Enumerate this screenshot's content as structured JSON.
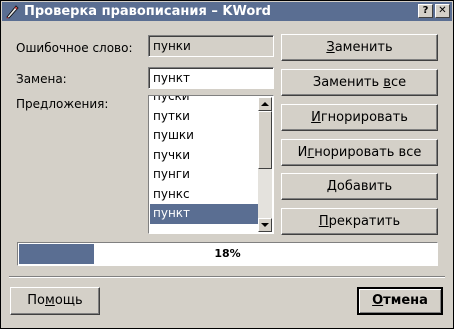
{
  "window": {
    "title": "Проверка правописания – KWord",
    "help_glyph": "?",
    "close_glyph": "✕",
    "icon": "kword-app-icon",
    "title_bar_color": "#5a6e92"
  },
  "form": {
    "misspelled_label": "Ошибочное слово:",
    "misspelled_value": "пунки",
    "replacement_label": "Замена:",
    "replacement_value": "пункт",
    "suggestions_label": "Предложения:"
  },
  "suggestions": {
    "items": [
      "пуски",
      "путки",
      "пушки",
      "пучки",
      "пунги",
      "пункс",
      "пункт"
    ],
    "selected_index": 6
  },
  "buttons": {
    "replace": {
      "pre": "",
      "mnemonic": "З",
      "post": "аменить"
    },
    "replace_all": {
      "pre": "Заменить ",
      "mnemonic": "в",
      "post": "се"
    },
    "ignore": {
      "pre": "",
      "mnemonic": "И",
      "post": "гнорировать"
    },
    "ignore_all": {
      "pre": "И",
      "mnemonic": "г",
      "post": "норировать все"
    },
    "add": {
      "pre": "",
      "mnemonic": "Д",
      "post": "обавить"
    },
    "stop": {
      "pre": "",
      "mnemonic": "П",
      "post": "рекратить"
    }
  },
  "progress": {
    "fraction": 0.18,
    "text": "18%"
  },
  "footer": {
    "help": {
      "pre": "По",
      "mnemonic": "м",
      "post": "ощь"
    },
    "cancel": {
      "pre": "",
      "mnemonic": "О",
      "post": "тмена"
    }
  }
}
